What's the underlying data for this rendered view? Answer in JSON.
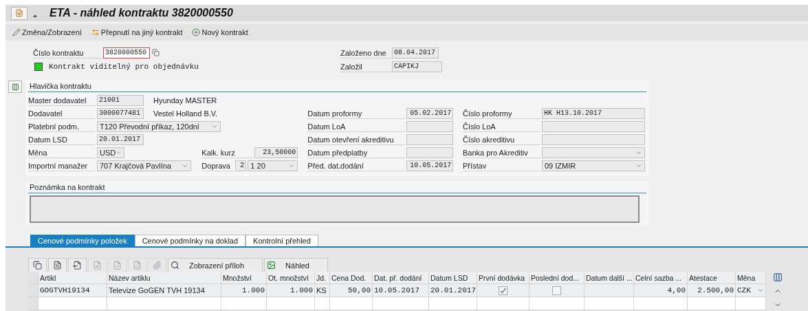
{
  "window": {
    "title": "ETA - náhled kontraktu 3820000550"
  },
  "toolbar": [
    {
      "label": "Změna/Zobrazení"
    },
    {
      "label": "Přepnutí na jiný kontrakt"
    },
    {
      "label": "Nový kontrakt"
    }
  ],
  "contract": {
    "number_label": "Číslo kontraktu",
    "number": "3820000550",
    "visible_label": "Kontrakt viditelný pro objednávku",
    "visible": true,
    "created_label": "Založeno dne",
    "created": "08.04.2017",
    "author_label": "Založil",
    "author": "CAPIKJ"
  },
  "header_panel": {
    "title": "Hlavička kontraktu",
    "left": [
      {
        "label": "Master dodavatel",
        "kind": "field",
        "value": "21001",
        "description": "Hyunday MASTER"
      },
      {
        "label": "Dodavatel",
        "kind": "field",
        "value": "3000077481",
        "description": "Vestel Holland B.V."
      },
      {
        "label": "Platební podm.",
        "kind": "dropdown",
        "value": "T120 Převodní příkaz, 120dní"
      },
      {
        "label": "Datum LSD",
        "kind": "field",
        "value": "20.01.2017"
      },
      {
        "label": "Měna",
        "kind": "dropdown",
        "value": "USD",
        "extra": {
          "label": "Kalk. kurz",
          "fields": [
            {
              "kind": "number",
              "value": "23,50000"
            }
          ]
        }
      },
      {
        "label": "Importní manažer",
        "kind": "dropdown",
        "value": "707 Krajčová Pavlína",
        "extra": {
          "label": "Doprava",
          "fields": [
            {
              "kind": "number",
              "value": "2"
            },
            {
              "kind": "dropdown",
              "value": "1 20"
            }
          ]
        }
      }
    ],
    "middle": [
      {
        "label": "Datum proformy",
        "kind": "field",
        "value": "05.02.2017"
      },
      {
        "label": "Datum LoA",
        "kind": "field"
      },
      {
        "label": "Datum otevření akreditivu",
        "kind": "field"
      },
      {
        "label": "Datum předplatby",
        "kind": "field"
      },
      {
        "label": "Před. dat.dodání",
        "kind": "field",
        "value": "10.05.2017"
      }
    ],
    "right": [
      {
        "label": "Číslo proformy",
        "kind": "field",
        "value": "HK H13.10.2017"
      },
      {
        "label": "Číslo LoA",
        "kind": "field"
      },
      {
        "label": "Číslo akreditivu",
        "kind": "field"
      },
      {
        "label": "Banka pro Akreditiv",
        "kind": "dropdown"
      },
      {
        "label": "Přístav",
        "kind": "dropdown",
        "value": "09 IZMIR"
      }
    ]
  },
  "note_panel": {
    "title": "Poznámka na kontrakt"
  },
  "tabs": [
    {
      "label": "Cenové podmínky položek",
      "selected": true
    },
    {
      "label": "Cenové podmínky na doklad",
      "selected": false
    },
    {
      "label": "Kontrolní přehled",
      "selected": false
    }
  ],
  "table_toolbar": [
    {
      "kind": "icon",
      "disabled": false
    },
    {
      "kind": "icon",
      "disabled": false
    },
    {
      "kind": "icon",
      "disabled": false
    },
    {
      "kind": "icon",
      "disabled": true
    },
    {
      "kind": "icon",
      "disabled": true
    },
    {
      "kind": "icon",
      "disabled": true
    },
    {
      "kind": "icon",
      "disabled": true
    },
    {
      "kind": "text",
      "label": "Zobrazení příloh",
      "disabled": false
    },
    {
      "kind": "text",
      "label": "Náhled",
      "disabled": false
    }
  ],
  "table": {
    "columns": [
      {
        "name": "Artikl",
        "kind": "code"
      },
      {
        "name": "Název artiklu",
        "kind": "text"
      },
      {
        "name": "Množství",
        "kind": "number"
      },
      {
        "name": "Ot. množství",
        "kind": "number"
      },
      {
        "name": "Jd.",
        "kind": "text"
      },
      {
        "name": "Cena Dod.",
        "kind": "number"
      },
      {
        "name": "Dat. př. dodání",
        "kind": "code"
      },
      {
        "name": "Datum LSD",
        "kind": "code"
      },
      {
        "name": "První dodávka",
        "kind": "checkbox"
      },
      {
        "name": "Poslední dod...",
        "kind": "checkbox"
      },
      {
        "name": "Datum další ...",
        "kind": "code"
      },
      {
        "name": "Celní sazba ...",
        "kind": "number"
      },
      {
        "name": "Atestace",
        "kind": "number"
      },
      {
        "name": "Měna",
        "kind": "dropdown"
      }
    ],
    "rows": [
      {
        "cells": [
          "GOGTVH19134",
          "Televize GoGEN TVH 19134",
          "1.000",
          "1.000",
          "KS",
          "50,00",
          "10.05.2017",
          "20.01.2017",
          true,
          false,
          null,
          "4,00",
          "2.500,00",
          "CZK"
        ]
      }
    ]
  }
}
